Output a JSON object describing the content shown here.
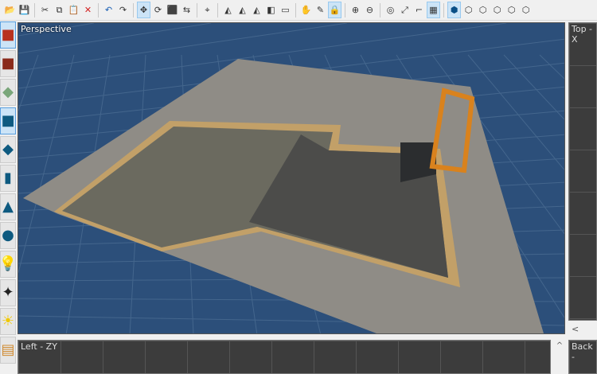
{
  "toolbar": {
    "items": [
      {
        "name": "open-icon",
        "glyph": "📂"
      },
      {
        "name": "save-icon",
        "glyph": "💾"
      },
      {
        "sep": true
      },
      {
        "name": "cut-icon",
        "glyph": "✂"
      },
      {
        "name": "copy-icon",
        "glyph": "⧉"
      },
      {
        "name": "paste-icon",
        "glyph": "📋"
      },
      {
        "name": "delete-icon",
        "glyph": "✕",
        "color": "#d32020"
      },
      {
        "sep": true
      },
      {
        "name": "undo-icon",
        "glyph": "↶",
        "color": "#1a5fb4"
      },
      {
        "name": "redo-icon",
        "glyph": "↷"
      },
      {
        "sep": true
      },
      {
        "name": "move-icon",
        "glyph": "✥",
        "on": true
      },
      {
        "name": "rotate-icon",
        "glyph": "⟳"
      },
      {
        "name": "scale-icon",
        "glyph": "⬛"
      },
      {
        "name": "swap-icon",
        "glyph": "⇆"
      },
      {
        "sep": true
      },
      {
        "name": "snap-icon",
        "glyph": "⌖"
      },
      {
        "sep": true
      },
      {
        "name": "align-1-icon",
        "glyph": "◭"
      },
      {
        "name": "align-2-icon",
        "glyph": "◭"
      },
      {
        "name": "align-3-icon",
        "glyph": "◭"
      },
      {
        "name": "bring-front-icon",
        "glyph": "◧"
      },
      {
        "name": "frame-icon",
        "glyph": "▭"
      },
      {
        "sep": true
      },
      {
        "name": "hand-icon",
        "glyph": "✋"
      },
      {
        "name": "eyedropper-icon",
        "glyph": "✎"
      },
      {
        "name": "lock-icon",
        "glyph": "🔒",
        "on": true
      },
      {
        "sep": true
      },
      {
        "name": "zoom-in-icon",
        "glyph": "⊕"
      },
      {
        "name": "zoom-out-icon",
        "glyph": "⊖"
      },
      {
        "sep": true
      },
      {
        "name": "focus-icon",
        "glyph": "◎"
      },
      {
        "name": "maximize-icon",
        "glyph": "⤢"
      },
      {
        "name": "text-icon",
        "glyph": "⌐"
      },
      {
        "name": "grid-icon",
        "glyph": "▦",
        "on": true
      },
      {
        "sep": true
      },
      {
        "name": "view-persp-icon",
        "glyph": "⬢",
        "on": true,
        "color": "#0b4f86"
      },
      {
        "name": "view-top-icon",
        "glyph": "⬡"
      },
      {
        "name": "view-front-icon",
        "glyph": "⬡"
      },
      {
        "name": "view-left-icon",
        "glyph": "⬡"
      },
      {
        "name": "view-back-icon",
        "glyph": "⬡"
      },
      {
        "name": "view-right-icon",
        "glyph": "⬡"
      }
    ]
  },
  "sidebar": {
    "items": [
      {
        "name": "red-cube-icon",
        "glyph": "■",
        "color": "#b8321e",
        "on": true
      },
      {
        "name": "dark-cube-icon",
        "glyph": "■",
        "color": "#8a2a1a"
      },
      {
        "name": "terrain-icon",
        "glyph": "◆",
        "color": "#7aa67a"
      },
      {
        "name": "box-icon",
        "glyph": "■",
        "color": "#0e5a80",
        "on": true
      },
      {
        "name": "wedge-icon",
        "glyph": "◆",
        "color": "#0e5a80"
      },
      {
        "name": "cylinder-icon",
        "glyph": "▮",
        "color": "#0e5a80"
      },
      {
        "name": "cone-icon",
        "glyph": "▲",
        "color": "#0e5a80"
      },
      {
        "name": "sphere-icon",
        "glyph": "●",
        "color": "#0e5a80"
      },
      {
        "name": "light-bulb-icon",
        "glyph": "💡",
        "color": "#f0d000"
      },
      {
        "name": "spotlight-icon",
        "glyph": "✦",
        "color": "#222"
      },
      {
        "name": "sun-icon",
        "glyph": "☀",
        "color": "#f0c800"
      },
      {
        "name": "crate-icon",
        "glyph": "▤",
        "color": "#d08a30"
      }
    ]
  },
  "viewports": {
    "perspective": "Perspective",
    "top": "Top - X",
    "left": "Left - ZY",
    "back": "Back -"
  },
  "colors": {
    "viewport_bg": "#2c4f7a",
    "ortho_bg": "#3c3c3c"
  }
}
